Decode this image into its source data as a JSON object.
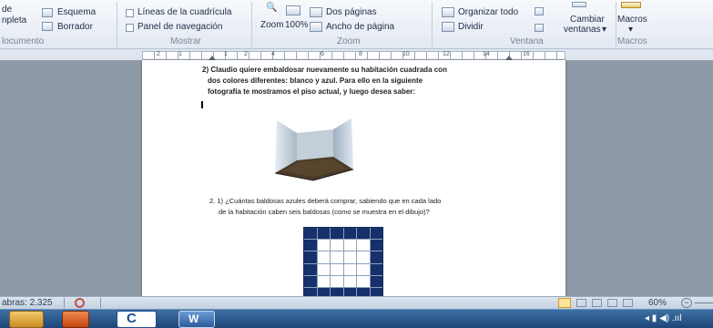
{
  "ribbon": {
    "left_frag": {
      "line1": "de",
      "line2": "npleta",
      "line3": "locumento"
    },
    "esquema": "Esquema",
    "borrador": "Borrador",
    "lineas": "Líneas de la cuadrícula",
    "panel": "Panel de navegación",
    "mostrar": "Mostrar",
    "zoom_btn": "Zoom",
    "zoom_pct": "100%",
    "dos_paginas": "Dos páginas",
    "ancho": "Ancho de página",
    "zoom_group": "Zoom",
    "organizar": "Organizar todo",
    "dividir": "Dividir",
    "ventana_group": "Ventana",
    "cambiar1": "Cambiar",
    "cambiar2": "ventanas",
    "macros": "Macros",
    "macros_group": "Macros"
  },
  "ruler": {
    "numbers": [
      "2",
      "1",
      "1",
      "2",
      "4",
      "6",
      "8",
      "10",
      "12",
      "14",
      "16"
    ]
  },
  "document": {
    "q2_line1": "2) Claudio quiere embaldosar nuevamente su habitación cuadrada con",
    "q2_line2": "dos colores diferentes: blanco y azul. Para ello en la siguiente",
    "q2_line3": "fotografía te mostramos el piso actual, y luego desea saber:",
    "q21_line1": "2. 1) ¿Cuántas baldosas azules deberá comprar, sabiendo que en cada lado",
    "q21_line2": "de la habitación caben seis baldosas (como se muestra en el dibujo)?"
  },
  "statusbar": {
    "words": "abras: 2.325",
    "zoom": "60%"
  },
  "taskbar": {
    "tray": "◂  ▮  ◀)  .ııl"
  },
  "colors": {
    "tile_blue": "#15306b",
    "tile_white": "#ffffff"
  }
}
